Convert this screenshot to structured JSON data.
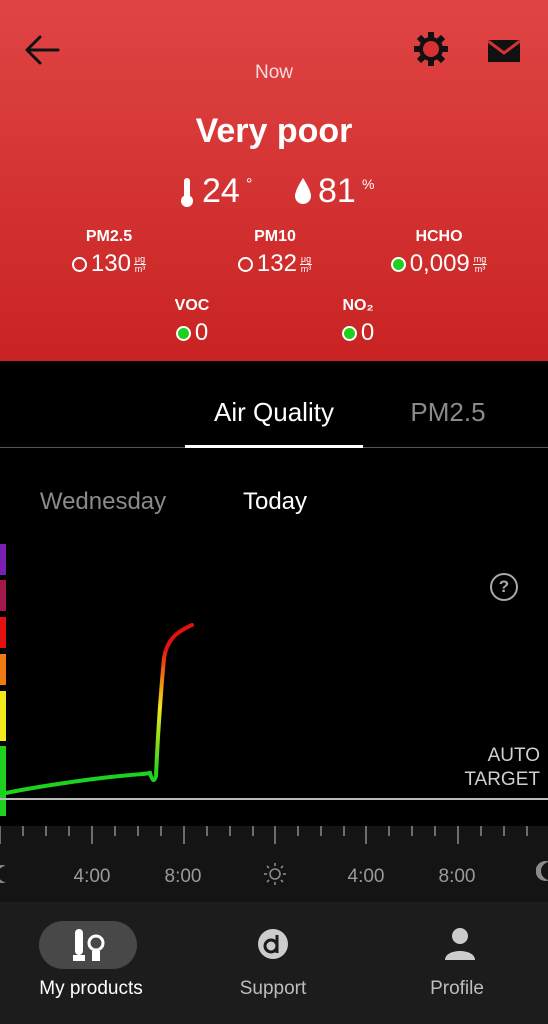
{
  "header": {
    "time_label": "Now",
    "status": "Very poor",
    "temperature": "24",
    "temperature_unit": "°",
    "humidity": "81",
    "humidity_unit": "%",
    "colors": {
      "background": "#d63232",
      "good": "#1ed11e"
    }
  },
  "metrics": [
    {
      "label": "PM2.5",
      "value": "130",
      "unit_top": "μg",
      "unit_bottom": "m³",
      "level": "poor"
    },
    {
      "label": "PM10",
      "value": "132",
      "unit_top": "μg",
      "unit_bottom": "m³",
      "level": "poor"
    },
    {
      "label": "HCHO",
      "value": "0,009",
      "unit_top": "mg",
      "unit_bottom": "m³",
      "level": "good"
    },
    {
      "label": "VOC",
      "value": "0",
      "level": "good"
    },
    {
      "label": "NO₂",
      "value": "0",
      "level": "good"
    }
  ],
  "tabs": [
    {
      "label": "Air Quality",
      "active": true
    },
    {
      "label": "PM2.5",
      "active": false
    }
  ],
  "days": [
    {
      "label": "Wednesday",
      "active": false
    },
    {
      "label": "Today",
      "active": true
    }
  ],
  "help_icon": "?",
  "auto_target": {
    "line1": "AUTO",
    "line2": "TARGET"
  },
  "timeline": {
    "labels": [
      "4:00",
      "8:00",
      "4:00",
      "8:00"
    ],
    "icons": [
      "moon-icon",
      "sun-icon",
      "moon-icon"
    ]
  },
  "scale_colors": [
    "#7a1fb4",
    "#a3174a",
    "#e31010",
    "#f07a12",
    "#f2e81b",
    "#1ed11e"
  ],
  "nav": [
    {
      "label": "My products",
      "icon": "products-icon",
      "active": true
    },
    {
      "label": "Support",
      "icon": "support-icon",
      "active": false
    },
    {
      "label": "Profile",
      "icon": "profile-icon",
      "active": false
    }
  ]
}
